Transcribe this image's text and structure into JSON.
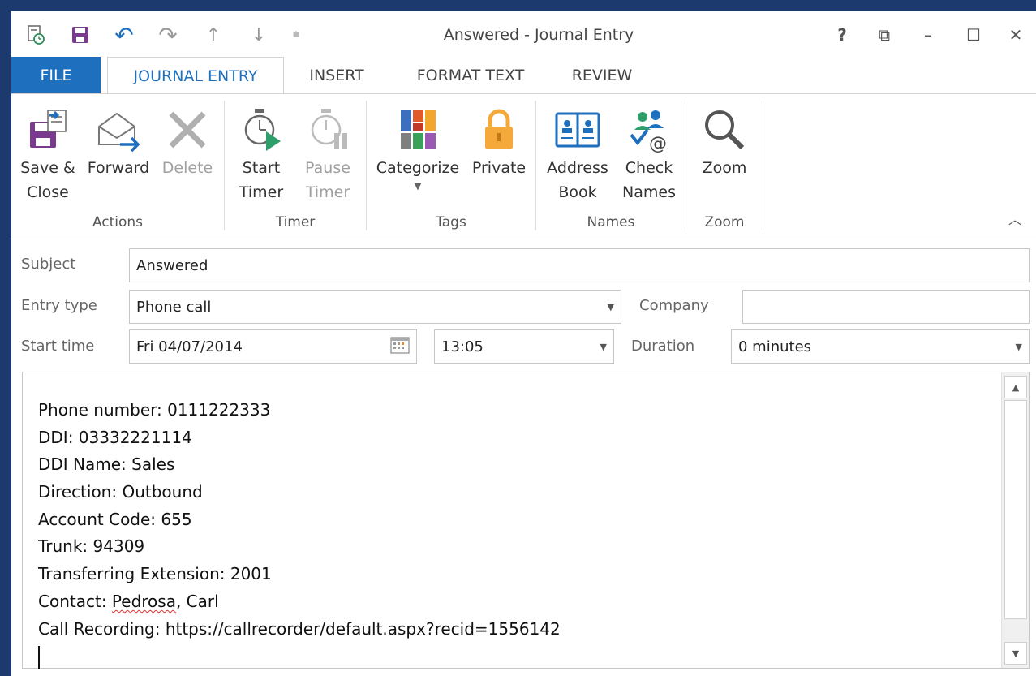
{
  "window": {
    "title": "Answered - Journal Entry"
  },
  "caption": {
    "help": "?",
    "restore_ribbon": "⧉",
    "minimize": "–",
    "maximize": "☐",
    "close": "✕"
  },
  "qat": {
    "undo": "↶",
    "redo": "↷",
    "up": "↑",
    "down": "↓",
    "customize": "⩧"
  },
  "tabs": [
    {
      "label": "FILE"
    },
    {
      "label": "JOURNAL ENTRY"
    },
    {
      "label": "INSERT"
    },
    {
      "label": "FORMAT TEXT"
    },
    {
      "label": "REVIEW"
    }
  ],
  "ribbon": {
    "actions": {
      "label": "Actions",
      "save_close_1": "Save &",
      "save_close_2": "Close",
      "forward": "Forward",
      "delete": "Delete"
    },
    "timer": {
      "label": "Timer",
      "start_1": "Start",
      "start_2": "Timer",
      "pause_1": "Pause",
      "pause_2": "Timer"
    },
    "tags": {
      "label": "Tags",
      "categorize": "Categorize",
      "private": "Private"
    },
    "names": {
      "label": "Names",
      "address_1": "Address",
      "address_2": "Book",
      "check_1": "Check",
      "check_2": "Names"
    },
    "zoom": {
      "label": "Zoom",
      "zoom": "Zoom"
    }
  },
  "form": {
    "subject_label": "Subject",
    "subject_value": "Answered",
    "entry_type_label": "Entry type",
    "entry_type_value": "Phone call",
    "company_label": "Company",
    "company_value": "",
    "start_time_label": "Start time",
    "start_date_value": "Fri 04/07/2014",
    "start_time_value": "13:05",
    "duration_label": "Duration",
    "duration_value": "0 minutes"
  },
  "body": {
    "lines": [
      "Phone number: 0111222333",
      "DDI: 03332221114",
      "DDI Name: Sales",
      "Direction: Outbound",
      "Account Code: 655",
      "Trunk: 94309",
      "Transferring Extension: 2001"
    ],
    "contact_prefix": "Contact: ",
    "contact_misspelled": "Pedrosa",
    "contact_suffix": ", Carl",
    "recording": "Call Recording: https://callrecorder/default.aspx?recid=1556142"
  }
}
